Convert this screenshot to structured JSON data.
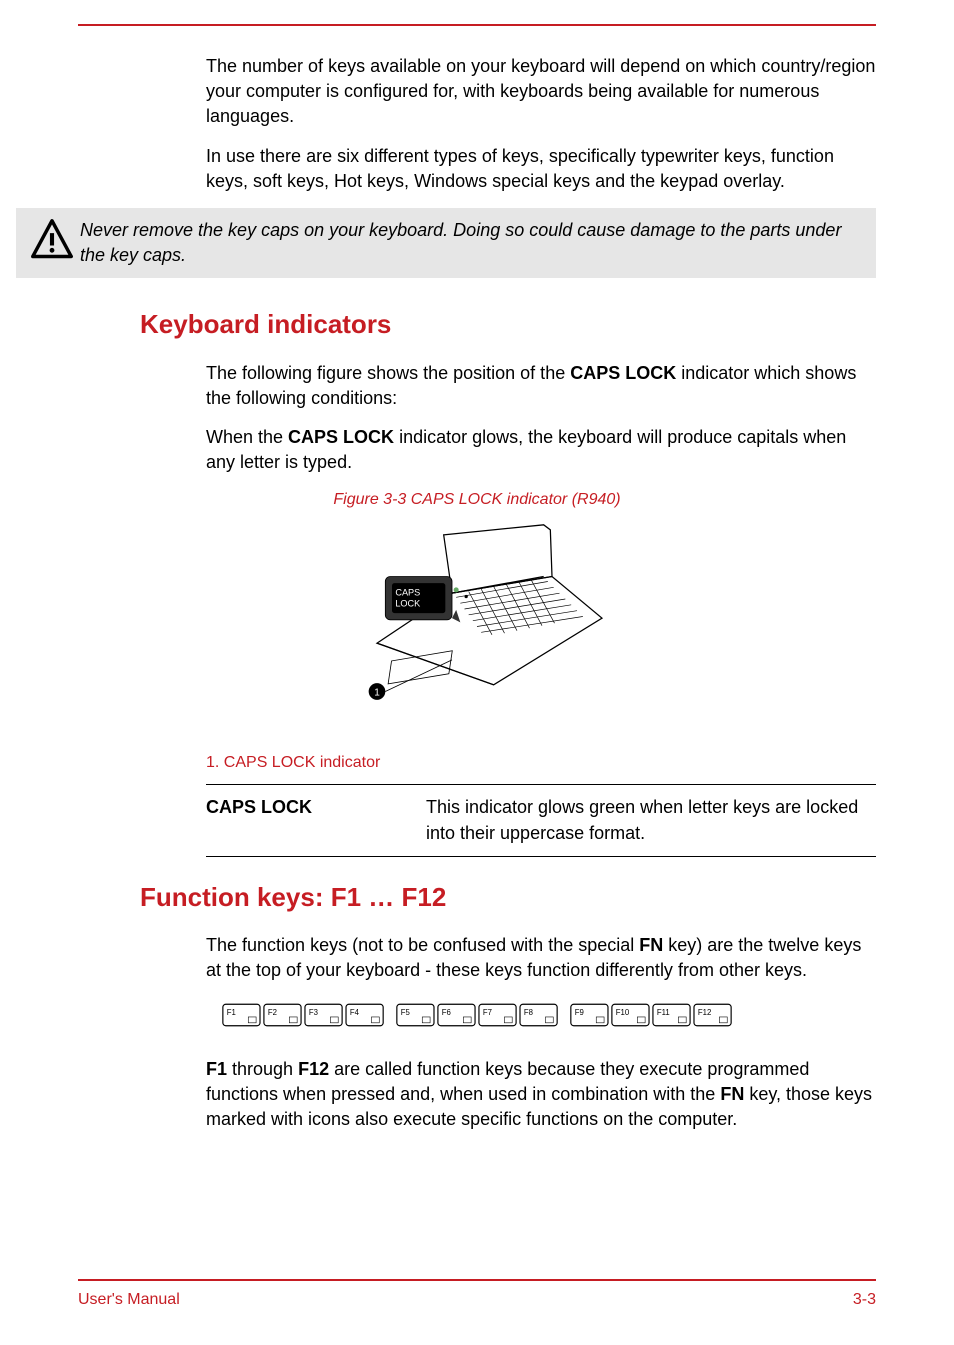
{
  "paragraphs": {
    "p1": "The number of keys available on your keyboard will depend on which country/region your computer is configured for, with keyboards being available for numerous languages.",
    "p2": "In use there are six different types of keys, specifically typewriter keys, function keys, soft keys, Hot keys, Windows special keys and the keypad overlay."
  },
  "callout": {
    "text": "Never remove the key caps on your keyboard. Doing so could cause damage to the parts under the key caps."
  },
  "section1": {
    "heading": "Keyboard indicators",
    "p1_a": "The following figure shows the position of the ",
    "p1_b": "CAPS LOCK",
    "p1_c": " indicator which shows the following conditions:",
    "p2_a": "When the ",
    "p2_b": "CAPS LOCK",
    "p2_c": " indicator glows, the keyboard will produce capitals when any letter is typed.",
    "figure_caption": "Figure 3-3 CAPS LOCK indicator (R940)",
    "figure_label": "1. CAPS LOCK indicator",
    "caps_label_line1": "CAPS",
    "caps_label_line2": "LOCK",
    "def_term": "CAPS LOCK",
    "def_desc": "This indicator glows green when letter keys are locked into their uppercase format."
  },
  "section2": {
    "heading": "Function keys: F1 … F12",
    "p1_a": "The function keys (not to be confused with the special ",
    "p1_b": "FN",
    "p1_c": " key) are the twelve keys at the top of your keyboard - these keys function differently from other keys.",
    "p2_a": "F1",
    "p2_b": " through ",
    "p2_c": "F12",
    "p2_d": " are called function keys because they execute programmed functions when pressed and, when used in combination with the ",
    "p2_e": "FN",
    "p2_f": " key, those keys marked with icons also execute specific functions on the computer."
  },
  "fkeys": [
    "F1",
    "F2",
    "F3",
    "F4",
    "F5",
    "F6",
    "F7",
    "F8",
    "F9",
    "F10",
    "F11",
    "F12"
  ],
  "footer": {
    "left": "User's Manual",
    "right": "3-3"
  }
}
